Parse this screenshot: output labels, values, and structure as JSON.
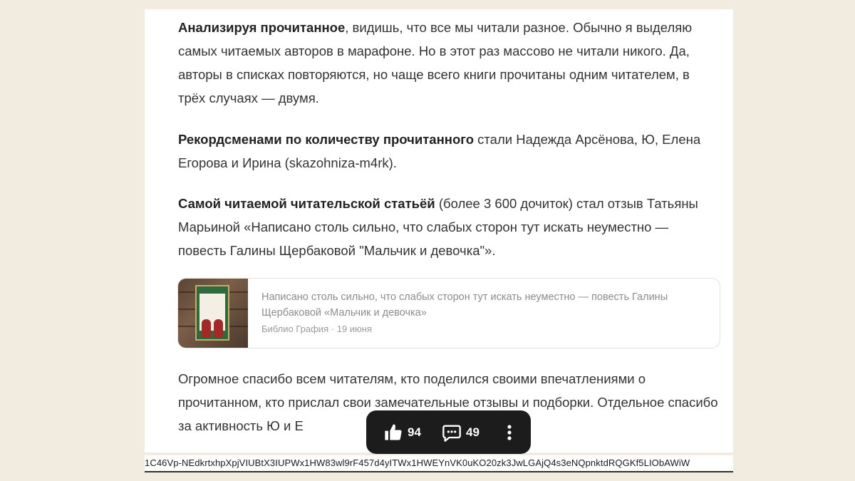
{
  "article": {
    "paragraphs": [
      {
        "bold": "Анализируя прочитанное",
        "text": ", видишь, что все мы читали разное. Обычно я выделяю самых читаемых авторов в марафоне. Но в этот раз массово не читали никого. Да, авторы в списках повторяются, но чаще всего книги прочитаны одним читателем, в трёх случаях — двумя."
      },
      {
        "bold": "Рекордсменами по количеству прочитанного",
        "text": " стали Надежда Арсёнова, Ю, Елена Егорова и Ирина (skazohniza-m4rk)."
      },
      {
        "bold": "Самой читаемой читательской статьёй",
        "text": " (более 3 600 дочиток) стал отзыв Татьяны Марьиной «Написано столь сильно, что слабых сторон тут искать неуместно — повесть Галины Щербаковой \"Мальчик и девочка\"»."
      },
      {
        "text": "Огромное спасибо всем читателям, кто поделился своими впечатлениями о прочитанном, кто прислал свои замечательные отзывы и подборки. Отдельное спасибо за активность Ю и Е"
      }
    ],
    "link_card": {
      "title": "Написано столь сильно, что слабых сторон тут искать неуместно — повесть Галины Щербаковой «Мальчик и девочка»",
      "source": "Библио Графия",
      "separator": "·",
      "date": "19 июня",
      "thumbnail_icon": "book-cover-thumbnail"
    }
  },
  "actions": {
    "likes": "94",
    "comments": "49",
    "like_icon": "thumbs-up-icon",
    "comment_icon": "comment-icon",
    "more_icon": "more-vertical-icon"
  },
  "url_bar": {
    "text": "1C46Vp-NEdkrtxhpXpjVIUBtX3IUPWx1HW83wl9rF457d4yITWx1HWEYnVK0uKO20zk3JwLGAjQ4s3eNQpnktdRQGKf5LIObAWiW"
  }
}
